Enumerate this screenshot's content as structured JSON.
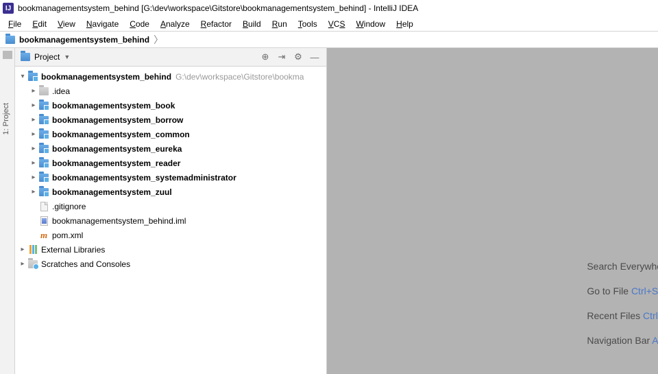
{
  "titlebar": {
    "app_icon_text": "IJ",
    "title": "bookmanagementsystem_behind [G:\\dev\\workspace\\Gitstore\\bookmanagementsystem_behind] - IntelliJ IDEA"
  },
  "menubar": {
    "items": [
      "File",
      "Edit",
      "View",
      "Navigate",
      "Code",
      "Analyze",
      "Refactor",
      "Build",
      "Run",
      "Tools",
      "VCS",
      "Window",
      "Help"
    ]
  },
  "navbar": {
    "crumb": "bookmanagementsystem_behind"
  },
  "stripe": {
    "project_tab": "1: Project"
  },
  "project_panel": {
    "header_title": "Project",
    "toolbar_icons": [
      "target-icon",
      "collapse-icon",
      "gear-icon",
      "minimize-icon"
    ]
  },
  "tree": {
    "root": {
      "label": "bookmanagementsystem_behind",
      "path": "G:\\dev\\workspace\\Gitstore\\bookma"
    },
    "children": [
      {
        "label": ".idea",
        "type": "folder"
      },
      {
        "label": "bookmanagementsystem_book",
        "type": "module"
      },
      {
        "label": "bookmanagementsystem_borrow",
        "type": "module"
      },
      {
        "label": "bookmanagementsystem_common",
        "type": "module"
      },
      {
        "label": "bookmanagementsystem_eureka",
        "type": "module"
      },
      {
        "label": "bookmanagementsystem_reader",
        "type": "module"
      },
      {
        "label": "bookmanagementsystem_systemadministrator",
        "type": "module"
      },
      {
        "label": "bookmanagementsystem_zuul",
        "type": "module"
      },
      {
        "label": ".gitignore",
        "type": "file-gray"
      },
      {
        "label": "bookmanagementsystem_behind.iml",
        "type": "file-iml"
      },
      {
        "label": "pom.xml",
        "type": "file-maven"
      }
    ],
    "external_libraries": "External Libraries",
    "scratches": "Scratches and Consoles"
  },
  "hints": [
    {
      "text": "Search Everywhe"
    },
    {
      "text": "Go to File ",
      "shortcut": "Ctrl+S"
    },
    {
      "text": "Recent Files ",
      "shortcut": "Ctrl+"
    },
    {
      "text": "Navigation Bar ",
      "shortcut": "A"
    }
  ]
}
